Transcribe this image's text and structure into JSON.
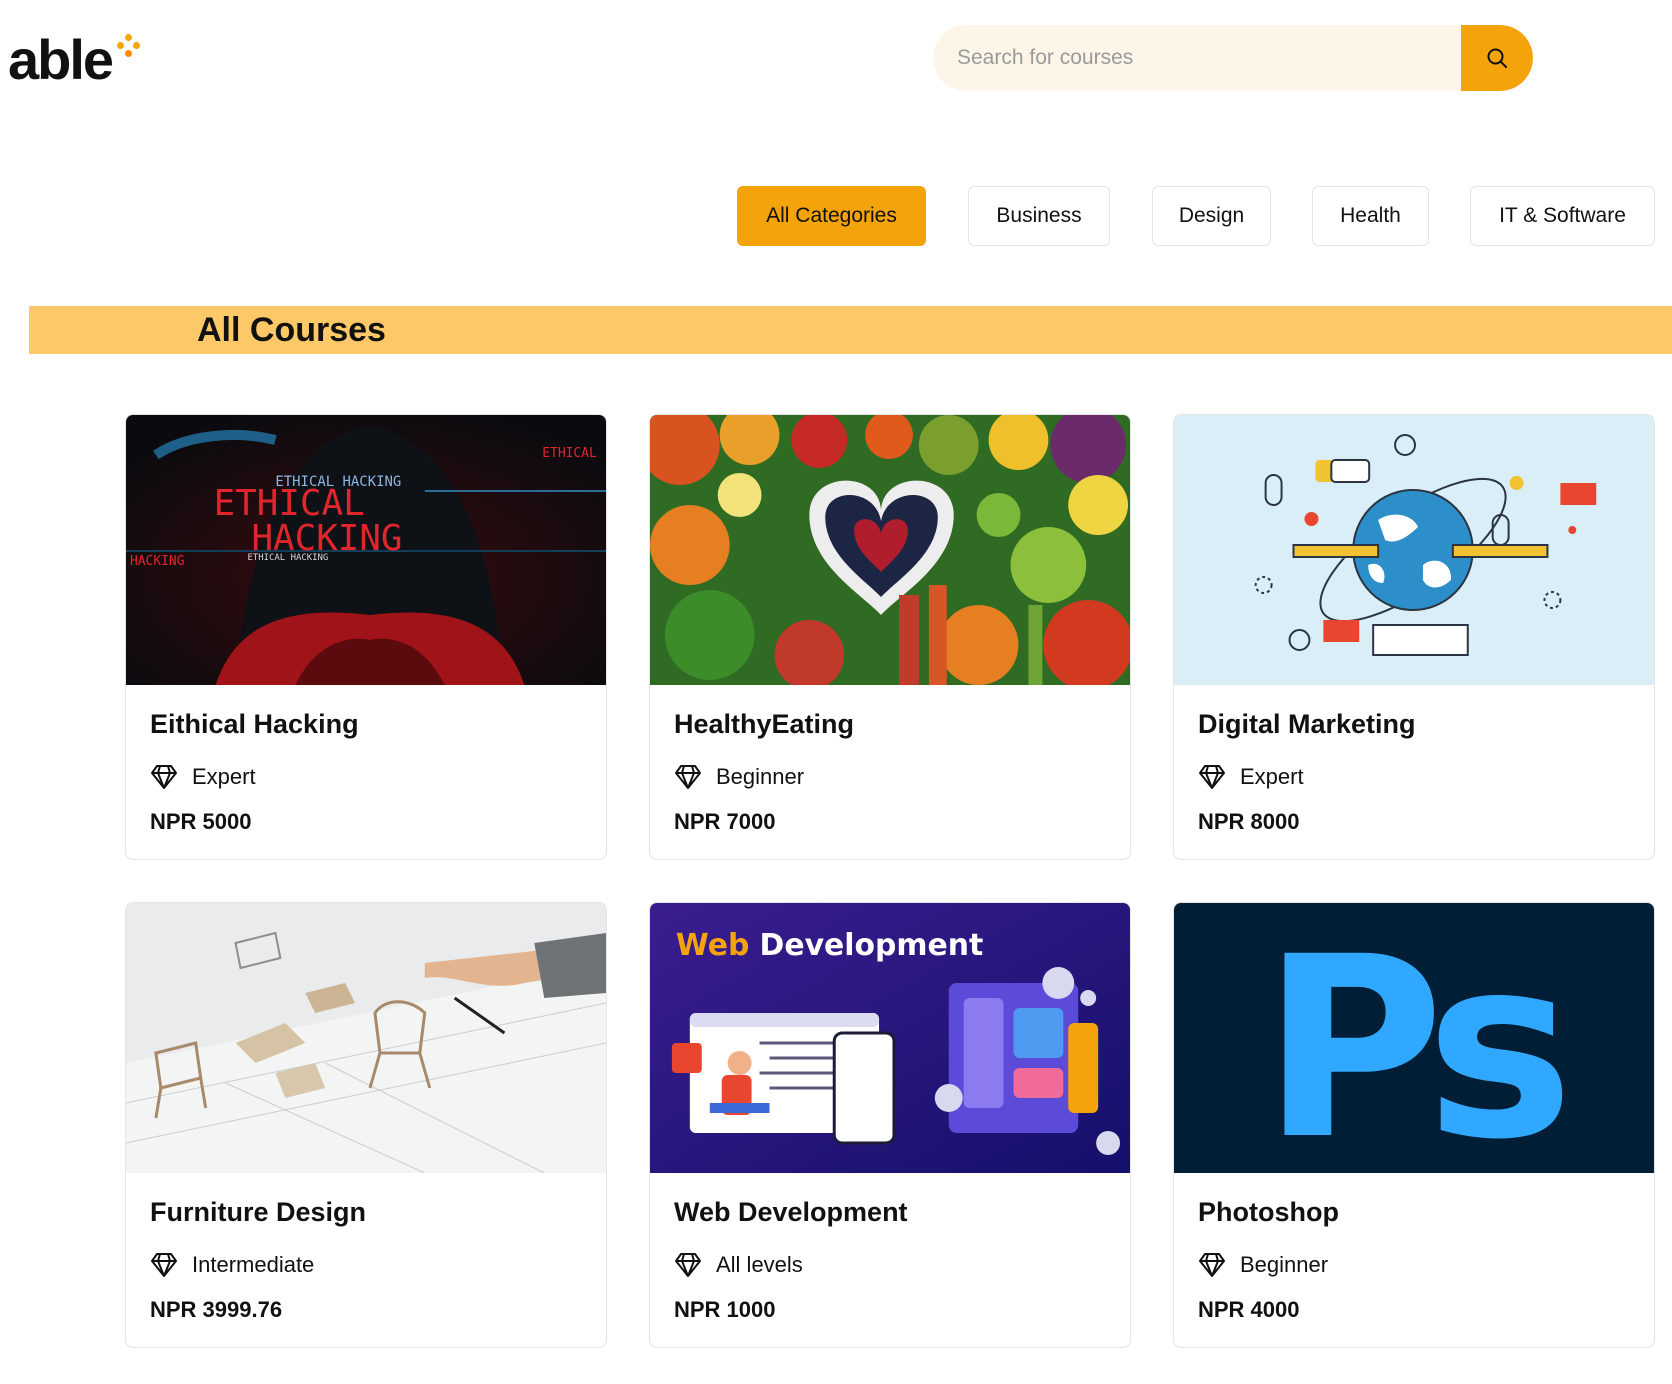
{
  "header": {
    "logo_text": "able",
    "search": {
      "placeholder": "Search for courses"
    }
  },
  "colors": {
    "accent": "#f5a30b",
    "banner": "#fdc867"
  },
  "categories": [
    {
      "label": "All Categories",
      "active": true
    },
    {
      "label": "Business",
      "active": false
    },
    {
      "label": "Design",
      "active": false
    },
    {
      "label": "Health",
      "active": false
    },
    {
      "label": "IT & Software",
      "active": false
    }
  ],
  "section_title": "All Courses",
  "courses": [
    {
      "title": "Eithical Hacking",
      "level": "Expert",
      "price": "NPR 5000",
      "thumb": {
        "banner_small": "ETHICAL HACKING",
        "big_line1": "ETHICAL",
        "big_line2": "HACKING",
        "tag_right": "ETHICAL",
        "tag_left": "HACKING",
        "tag_sub": "ETHICAL HACKING"
      }
    },
    {
      "title": "HealthyEating",
      "level": "Beginner",
      "price": "NPR 7000"
    },
    {
      "title": "Digital Marketing",
      "level": "Expert",
      "price": "NPR 8000"
    },
    {
      "title": "Furniture Design",
      "level": "Intermediate",
      "price": "NPR 3999.76"
    },
    {
      "title": "Web Development",
      "level": "All levels",
      "price": "NPR 1000",
      "thumb": {
        "word1": "Web",
        "word2": "Development"
      }
    },
    {
      "title": "Photoshop",
      "level": "Beginner",
      "price": "NPR 4000",
      "thumb": {
        "logo": "Ps"
      }
    }
  ]
}
